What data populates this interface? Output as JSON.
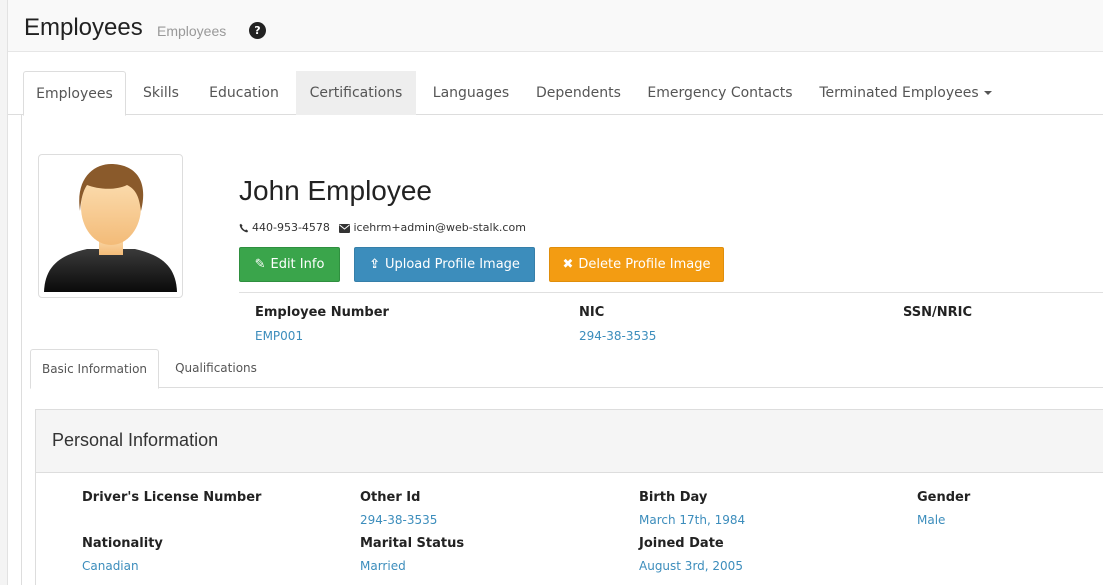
{
  "header": {
    "title": "Employees",
    "subtitle": "Employees",
    "help_icon": "?"
  },
  "tabs": [
    {
      "label": "Employees",
      "active": true
    },
    {
      "label": "Skills"
    },
    {
      "label": "Education"
    },
    {
      "label": "Certifications"
    },
    {
      "label": "Languages"
    },
    {
      "label": "Dependents"
    },
    {
      "label": "Emergency Contacts"
    },
    {
      "label": "Terminated Employees",
      "dropdown": true
    }
  ],
  "profile": {
    "name": "John Employee",
    "phone": "440-953-4578",
    "email": "icehrm+admin@web-stalk.com",
    "buttons": {
      "edit": "Edit Info",
      "upload": "Upload Profile Image",
      "delete": "Delete Profile Image"
    },
    "fields": [
      {
        "label": "Employee Number",
        "value": "EMP001"
      },
      {
        "label": "NIC",
        "value": "294-38-3535"
      },
      {
        "label": "SSN/NRIC",
        "value": ""
      }
    ]
  },
  "subtabs": [
    {
      "label": "Basic Information",
      "active": true
    },
    {
      "label": "Qualifications"
    }
  ],
  "personal": {
    "title": "Personal Information",
    "fields": [
      {
        "label": "Driver's License Number",
        "value": ""
      },
      {
        "label": "Other Id",
        "value": "294-38-3535"
      },
      {
        "label": "Birth Day",
        "value": "March 17th, 1984"
      },
      {
        "label": "Gender",
        "value": "Male"
      },
      {
        "label": "Nationality",
        "value": "Canadian"
      },
      {
        "label": "Marital Status",
        "value": "Married"
      },
      {
        "label": "Joined Date",
        "value": "August 3rd, 2005"
      }
    ]
  },
  "colors": {
    "link": "#3c8dbc",
    "edit_button": "#3aa54b",
    "upload_button": "#3c8dbc",
    "delete_button": "#f39c12"
  },
  "icons": {
    "help": "question-circle-icon",
    "phone": "phone-icon",
    "email": "envelope-icon",
    "edit": "edit-icon",
    "upload": "upload-icon",
    "delete": "times-icon",
    "avatar": "user-avatar-icon"
  }
}
